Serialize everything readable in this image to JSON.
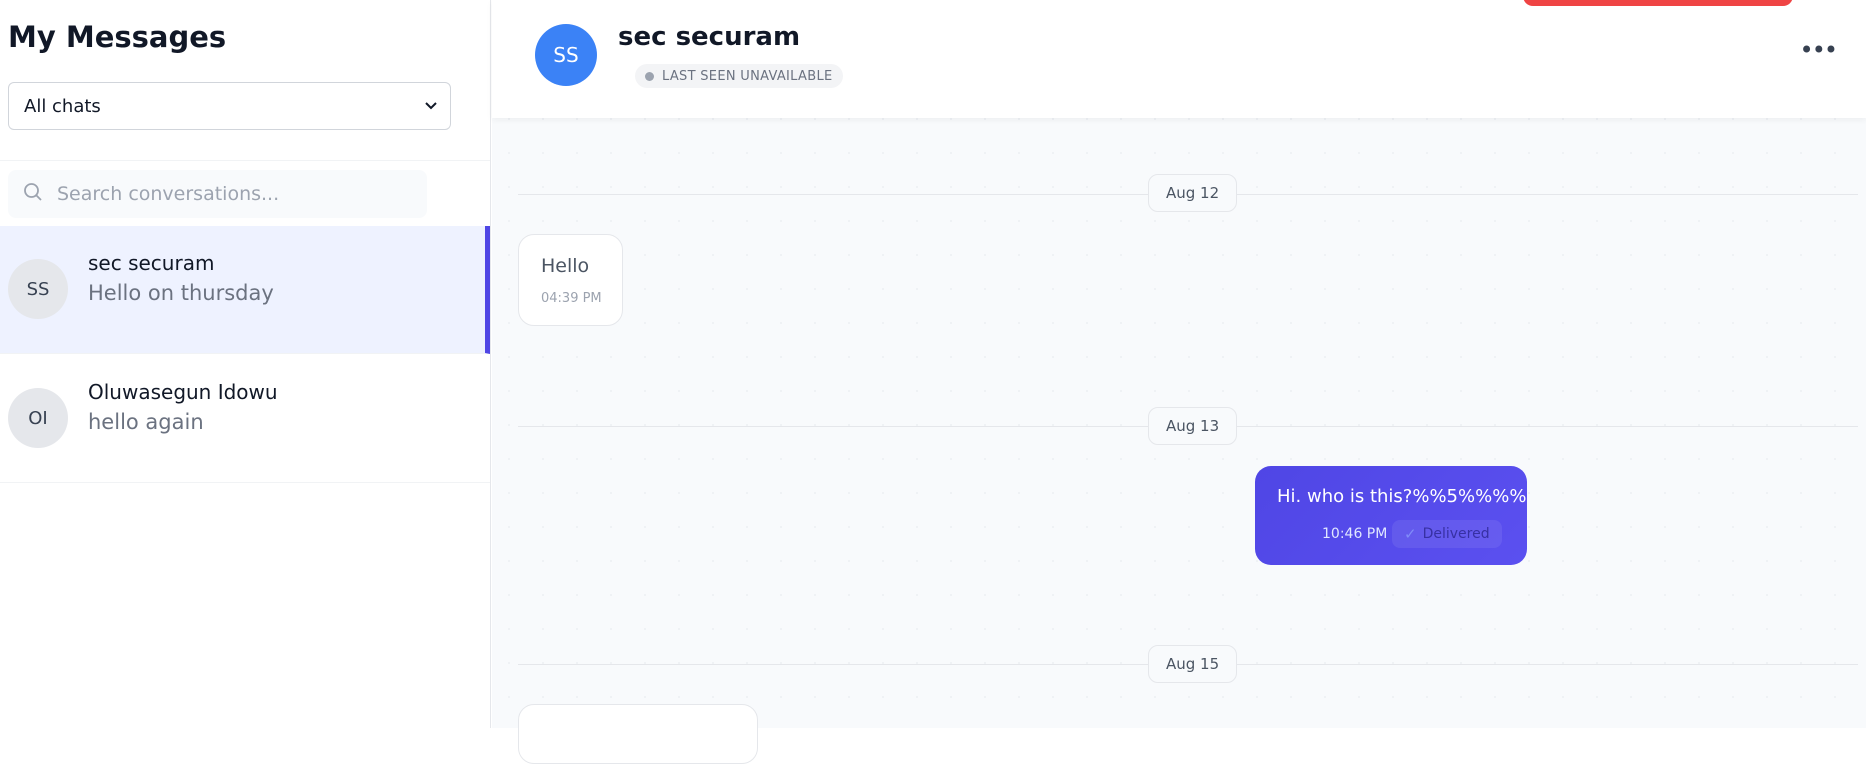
{
  "sidebar": {
    "title": "My Messages",
    "filter": {
      "selected": "All chats"
    },
    "search": {
      "placeholder": "Search conversations..."
    },
    "conversations": [
      {
        "initials": "SS",
        "name": "sec securam",
        "preview": "Hello on thursday",
        "active": true
      },
      {
        "initials": "OI",
        "name": "Oluwasegun Idowu",
        "preview": "hello again",
        "active": false
      }
    ]
  },
  "header": {
    "initials": "SS",
    "name": "sec securam",
    "status": "LAST SEEN UNAVAILABLE",
    "more_icon": "more-horizontal-icon"
  },
  "messages": {
    "days": [
      "Aug 12",
      "Aug 13",
      "Aug 15"
    ],
    "items": [
      {
        "direction": "incoming",
        "text": "Hello",
        "time": "04:39 PM"
      },
      {
        "direction": "outgoing",
        "text": "Hi. who is this?%%5%%%%",
        "time": "10:46 PM",
        "status": "Delivered"
      }
    ]
  },
  "colors": {
    "accent": "#4f46e5",
    "avatar_header": "#3b82f6",
    "alert": "#ef4444"
  }
}
